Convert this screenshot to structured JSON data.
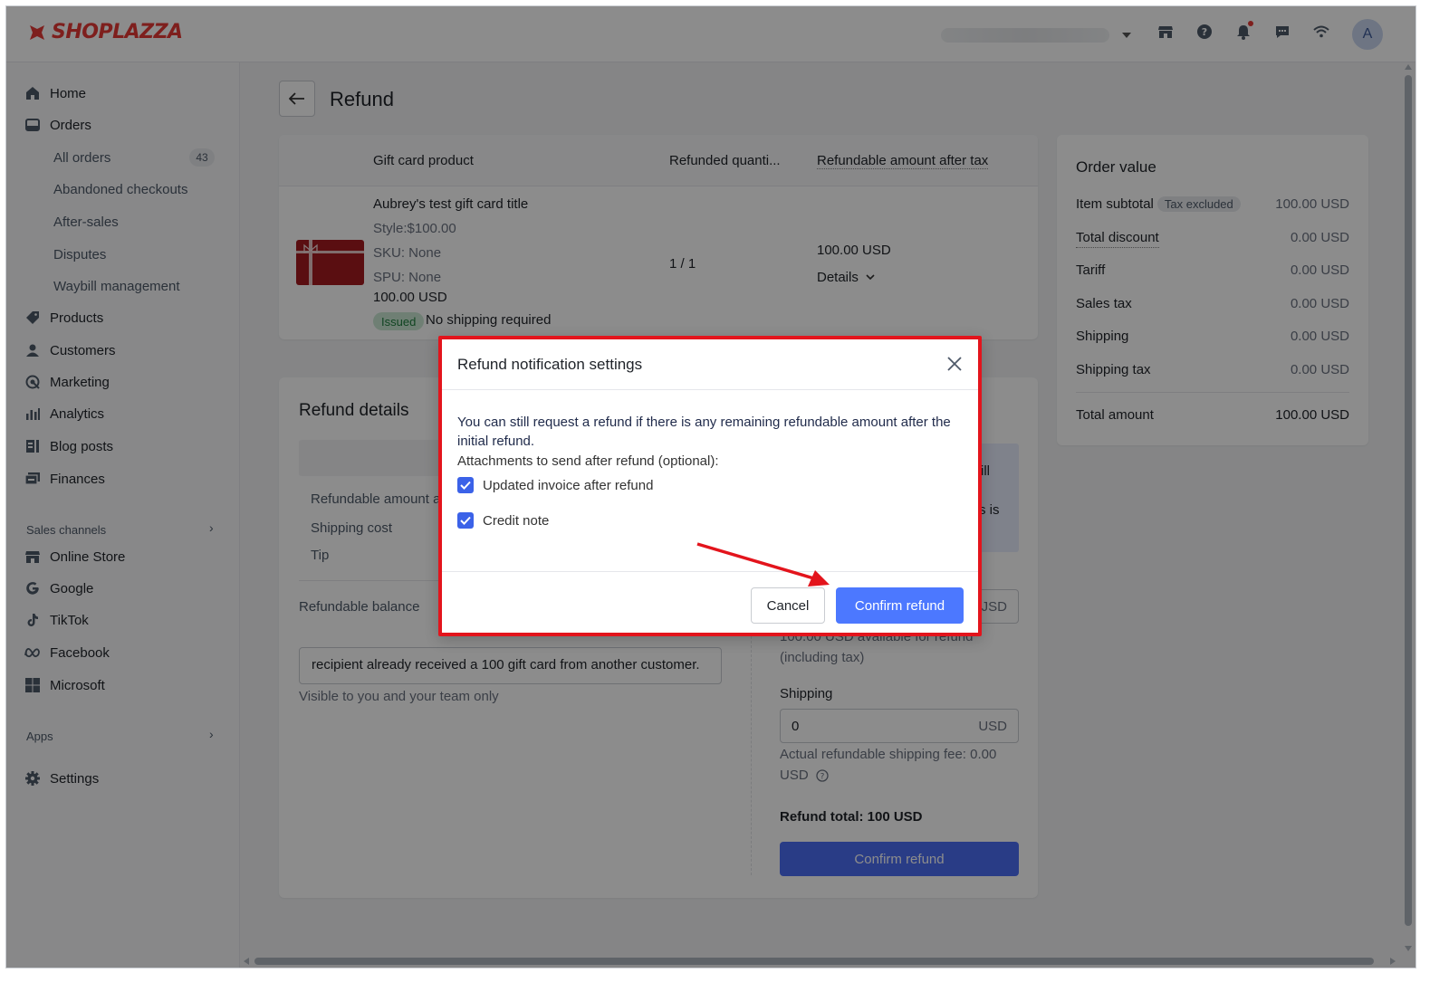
{
  "app": {
    "brand": "SHOPLAZZA",
    "brand_color": "#e53935",
    "accent": "#4c78ff",
    "annotation_color": "#e3141c"
  },
  "topbar": {
    "avatar_letter": "A",
    "icons": [
      "store-icon",
      "help-icon",
      "bell-icon",
      "chat-icon",
      "wifi-icon"
    ]
  },
  "sidebar": {
    "home": "Home",
    "orders": "Orders",
    "all_orders": "All orders",
    "all_orders_count": "43",
    "abandoned": "Abandoned checkouts",
    "after_sales": "After-sales",
    "disputes": "Disputes",
    "waybill": "Waybill management",
    "products": "Products",
    "customers": "Customers",
    "marketing": "Marketing",
    "analytics": "Analytics",
    "blog": "Blog posts",
    "finances": "Finances",
    "sales_channels": "Sales channels",
    "online_store": "Online Store",
    "google": "Google",
    "tiktok": "TikTok",
    "facebook": "Facebook",
    "microsoft": "Microsoft",
    "apps": "Apps",
    "settings": "Settings"
  },
  "page": {
    "title": "Refund"
  },
  "product_table": {
    "col_product": "Gift card product",
    "col_qty": "Refunded quanti...",
    "col_amount": "Refundable amount after tax",
    "name": "Aubrey's test gift card title",
    "style": "Style:$100.00",
    "sku": "SKU: None",
    "spu": "SPU: None",
    "price": "100.00 USD",
    "status": "Issued",
    "shipping_note": "No shipping required",
    "qty": "1 / 1",
    "amount": "100.00 USD",
    "details": "Details"
  },
  "order_value": {
    "title": "Order value",
    "rows": [
      {
        "label": "Item subtotal",
        "tag": "Tax excluded",
        "value": "100.00 USD"
      },
      {
        "label": "Total discount",
        "value": "0.00 USD"
      },
      {
        "label": "Tariff",
        "value": "0.00 USD"
      },
      {
        "label": "Sales tax",
        "value": "0.00 USD"
      },
      {
        "label": "Shipping",
        "value": "0.00 USD"
      },
      {
        "label": "Shipping tax",
        "value": "0.00 USD"
      }
    ],
    "total_label": "Total amount",
    "total_value": "100.00 USD"
  },
  "refund_details": {
    "title": "Refund details",
    "refundable_amount": "Refundable amount a",
    "shipping_cost": "Shipping cost",
    "tip": "Tip",
    "refundable_balance": "Refundable balance",
    "info_frag_1": "ill",
    "info_frag_2": "s is",
    "amount_unit": "JSD",
    "available_note": "100.00 USD available for refund",
    "including_tax": "(including tax)",
    "note_value": "recipient already received a 100 gift card from another customer.",
    "note_hint": "Visible to you and your team only",
    "shipping_label": "Shipping",
    "shipping_value": "0",
    "shipping_unit": "USD",
    "actual_fee": "Actual refundable shipping fee: 0.00",
    "actual_fee_unit": "USD",
    "refund_total": "Refund total: 100 USD",
    "confirm": "Confirm refund"
  },
  "modal": {
    "title": "Refund notification settings",
    "message": "You can still request a refund if there is any remaining refundable amount after the initial refund.",
    "attachments_label": "Attachments to send after refund (optional):",
    "option_invoice": "Updated invoice after refund",
    "option_invoice_checked": true,
    "option_credit": "Credit note",
    "option_credit_checked": true,
    "cancel": "Cancel",
    "confirm": "Confirm refund"
  }
}
